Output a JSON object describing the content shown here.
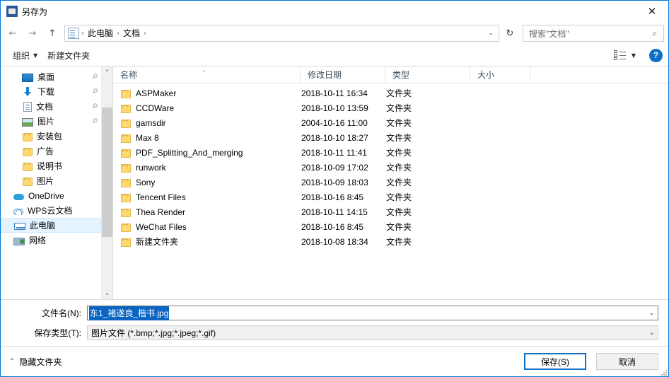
{
  "window": {
    "title": "另存为",
    "close_label": "✕",
    "app_icon": "save-as-icon"
  },
  "nav": {
    "back_label": "←",
    "forward_label": "→",
    "up_label": "↑",
    "breadcrumbs": [
      "此电脑",
      "文档"
    ],
    "separator": "›",
    "dropdown_caret": "⌄",
    "refresh_label": "↻"
  },
  "search": {
    "placeholder": "搜索\"文档\"",
    "icon": "⌕"
  },
  "toolbar": {
    "organize_label": "组织",
    "organize_caret": "▼",
    "new_folder_label": "新建文件夹",
    "view_caret": "▼",
    "help_label": "?"
  },
  "sidebar": {
    "items": [
      {
        "label": "桌面",
        "icon": "desktop",
        "pinned": true,
        "indent": true,
        "selected": false
      },
      {
        "label": "下载",
        "icon": "download",
        "pinned": true,
        "indent": true,
        "selected": false
      },
      {
        "label": "文档",
        "icon": "doc",
        "pinned": true,
        "indent": true,
        "selected": false
      },
      {
        "label": "图片",
        "icon": "pic",
        "pinned": true,
        "indent": true,
        "selected": false
      },
      {
        "label": "安装包",
        "icon": "folder",
        "pinned": false,
        "indent": true,
        "selected": false
      },
      {
        "label": "广告",
        "icon": "folder",
        "pinned": false,
        "indent": true,
        "selected": false
      },
      {
        "label": "说明书",
        "icon": "folder",
        "pinned": false,
        "indent": true,
        "selected": false
      },
      {
        "label": "图片",
        "icon": "folder",
        "pinned": false,
        "indent": true,
        "selected": false
      },
      {
        "label": "OneDrive",
        "icon": "onedrive",
        "pinned": false,
        "indent": false,
        "selected": false
      },
      {
        "label": "WPS云文档",
        "icon": "wps",
        "pinned": false,
        "indent": false,
        "selected": false
      },
      {
        "label": "此电脑",
        "icon": "pc",
        "pinned": false,
        "indent": false,
        "selected": true
      },
      {
        "label": "网络",
        "icon": "network",
        "pinned": false,
        "indent": false,
        "selected": false
      }
    ],
    "scroll_up": "⌃",
    "scroll_down": "⌄"
  },
  "filelist": {
    "columns": [
      "名称",
      "修改日期",
      "类型",
      "大小"
    ],
    "sort_indicator": "⌃",
    "rows": [
      {
        "name": "ASPMaker",
        "date": "2018-10-11 16:34",
        "type": "文件夹",
        "size": ""
      },
      {
        "name": "CCDWare",
        "date": "2018-10-10 13:59",
        "type": "文件夹",
        "size": ""
      },
      {
        "name": "gamsdir",
        "date": "2004-10-16 11:00",
        "type": "文件夹",
        "size": ""
      },
      {
        "name": "Max 8",
        "date": "2018-10-10 18:27",
        "type": "文件夹",
        "size": ""
      },
      {
        "name": "PDF_Splitting_And_merging",
        "date": "2018-10-11 11:41",
        "type": "文件夹",
        "size": ""
      },
      {
        "name": "runwork",
        "date": "2018-10-09 17:02",
        "type": "文件夹",
        "size": ""
      },
      {
        "name": "Sony",
        "date": "2018-10-09 18:03",
        "type": "文件夹",
        "size": ""
      },
      {
        "name": "Tencent Files",
        "date": "2018-10-16 8:45",
        "type": "文件夹",
        "size": ""
      },
      {
        "name": "Thea Render",
        "date": "2018-10-11 14:15",
        "type": "文件夹",
        "size": ""
      },
      {
        "name": "WeChat Files",
        "date": "2018-10-16 8:45",
        "type": "文件夹",
        "size": ""
      },
      {
        "name": "新建文件夹",
        "date": "2018-10-08 18:34",
        "type": "文件夹",
        "size": ""
      }
    ]
  },
  "form": {
    "filename_label": "文件名(N):",
    "filename_value": "东1_褚遂良_楷书.jpg",
    "filetype_label": "保存类型(T):",
    "filetype_value": "图片文件 (*.bmp;*.jpg;*.jpeg;*.gif)",
    "dropdown_caret": "⌄"
  },
  "footer": {
    "hide_folders_label": "隐藏文件夹",
    "hide_folders_caret": "⌃",
    "save_label": "保存(S)",
    "cancel_label": "取消"
  },
  "colors": {
    "accent": "#0078d7",
    "selection": "#0a64c2",
    "selected_row": "#e5f3ff",
    "folder": "#ffd870"
  }
}
